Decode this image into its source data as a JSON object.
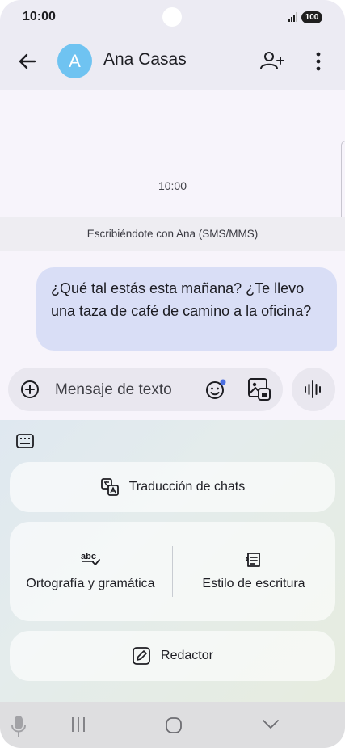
{
  "status_bar": {
    "time": "10:00",
    "battery": "100"
  },
  "header": {
    "contact_name": "Ana Casas",
    "avatar_letter": "A"
  },
  "chat": {
    "timestamp": "10:00",
    "sms_banner": "Escribiéndote con Ana (SMS/MMS)",
    "messages": [
      {
        "text": "¿Qué tal estás esta mañana? ¿Te llevo una taza de café de camino a la oficina?",
        "direction": "outgoing"
      }
    ]
  },
  "composer": {
    "placeholder": "Mensaje de texto"
  },
  "suggestions": {
    "translate_label": "Traducción de chats",
    "spelling_label": "Ortografía y gramática",
    "style_label": "Estilo de escritura",
    "writer_label": "Redactor"
  },
  "icons": {
    "back": "arrow-left-icon",
    "add_contact": "add-person-icon",
    "more": "more-vertical-icon",
    "plus": "plus-circle-icon",
    "emoji": "emoji-icon",
    "gallery": "gallery-icon",
    "voice": "voice-wave-icon",
    "keyboard": "keyboard-icon",
    "translate": "translate-icon",
    "spelling": "abc-check-icon",
    "style": "writing-style-icon",
    "writer": "pencil-icon"
  },
  "colors": {
    "avatar": "#6fc3f1",
    "bubble": "#d9def6",
    "emoji_dot": "#4a6ee0"
  }
}
